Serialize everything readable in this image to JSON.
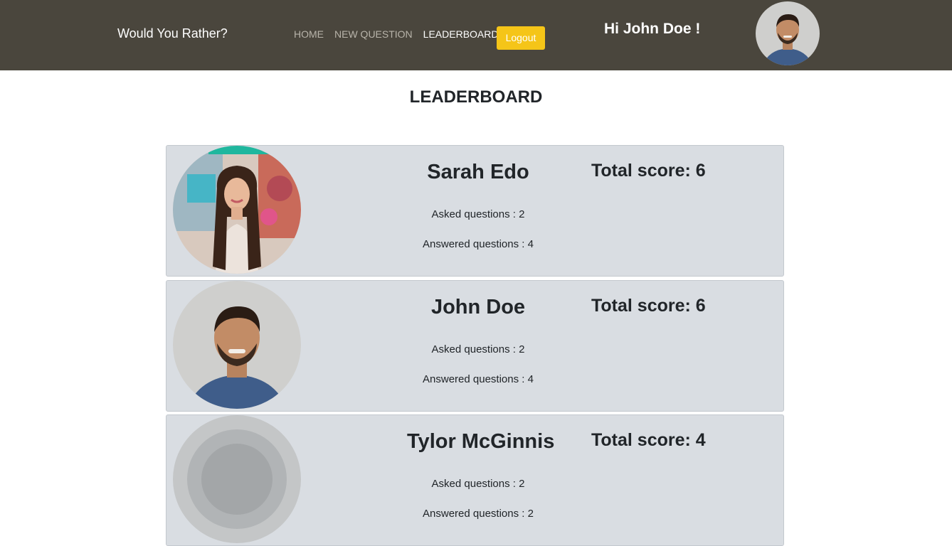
{
  "navbar": {
    "brand": "Would You Rather?",
    "links": [
      "HOME",
      "NEW QUESTION",
      "LEADERBOARD"
    ],
    "logout_label": "Logout",
    "greeting": "Hi John Doe !",
    "avatar_icon": "male-user-avatar"
  },
  "page": {
    "title": "LEADERBOARD"
  },
  "leaderboard": [
    {
      "name": "Sarah Edo",
      "asked": "Asked questions : 2",
      "answered": "Answered questions : 4",
      "score": "Total score: 6",
      "avatar_icon": "female-user-avatar"
    },
    {
      "name": "John Doe",
      "asked": "Asked questions : 2",
      "answered": "Answered questions : 4",
      "score": "Total score: 6",
      "avatar_icon": "male-user-avatar"
    },
    {
      "name": "Tylor McGinnis",
      "asked": "Asked questions : 2",
      "answered": "Answered questions : 2",
      "score": "Total score: 4",
      "avatar_icon": "user-avatar"
    }
  ],
  "colors": {
    "navbar": "#4a463d",
    "logout": "#f5c518",
    "card": "#d9dde2"
  }
}
